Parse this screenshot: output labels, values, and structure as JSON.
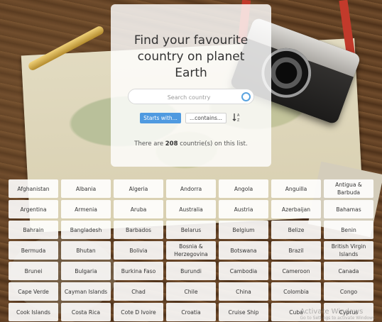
{
  "card": {
    "title": "Find your favourite country on planet Earth",
    "search_placeholder": "Search country",
    "starts_with_label": "Starts with...",
    "contains_label": "...contains...",
    "count_prefix": "There are ",
    "count_value": "208",
    "count_suffix": " countrie(s) on this list."
  },
  "countries": [
    "Afghanistan",
    "Albania",
    "Algeria",
    "Andorra",
    "Angola",
    "Anguilla",
    "Antigua & Barbuda",
    "Argentina",
    "Armenia",
    "Aruba",
    "Australia",
    "Austria",
    "Azerbaijan",
    "Bahamas",
    "Bahrain",
    "Bangladesh",
    "Barbados",
    "Belarus",
    "Belgium",
    "Belize",
    "Benin",
    "Bermuda",
    "Bhutan",
    "Bolivia",
    "Bosnia & Herzegovina",
    "Botswana",
    "Brazil",
    "British Virgin Islands",
    "Brunei",
    "Bulgaria",
    "Burkina Faso",
    "Burundi",
    "Cambodia",
    "Cameroon",
    "Canada",
    "Cape Verde",
    "Cayman Islands",
    "Chad",
    "Chile",
    "China",
    "Colombia",
    "Congo",
    "Cook Islands",
    "Costa Rica",
    "Cote D Ivoire",
    "Croatia",
    "Cruise Ship",
    "Cuba",
    "Cyprus"
  ],
  "watermark": {
    "line1": "Activate Windows",
    "line2": "Go to Settings to activate Windows."
  },
  "colors": {
    "accent": "#4f9ae0",
    "search_icon": "#5aa3df"
  }
}
